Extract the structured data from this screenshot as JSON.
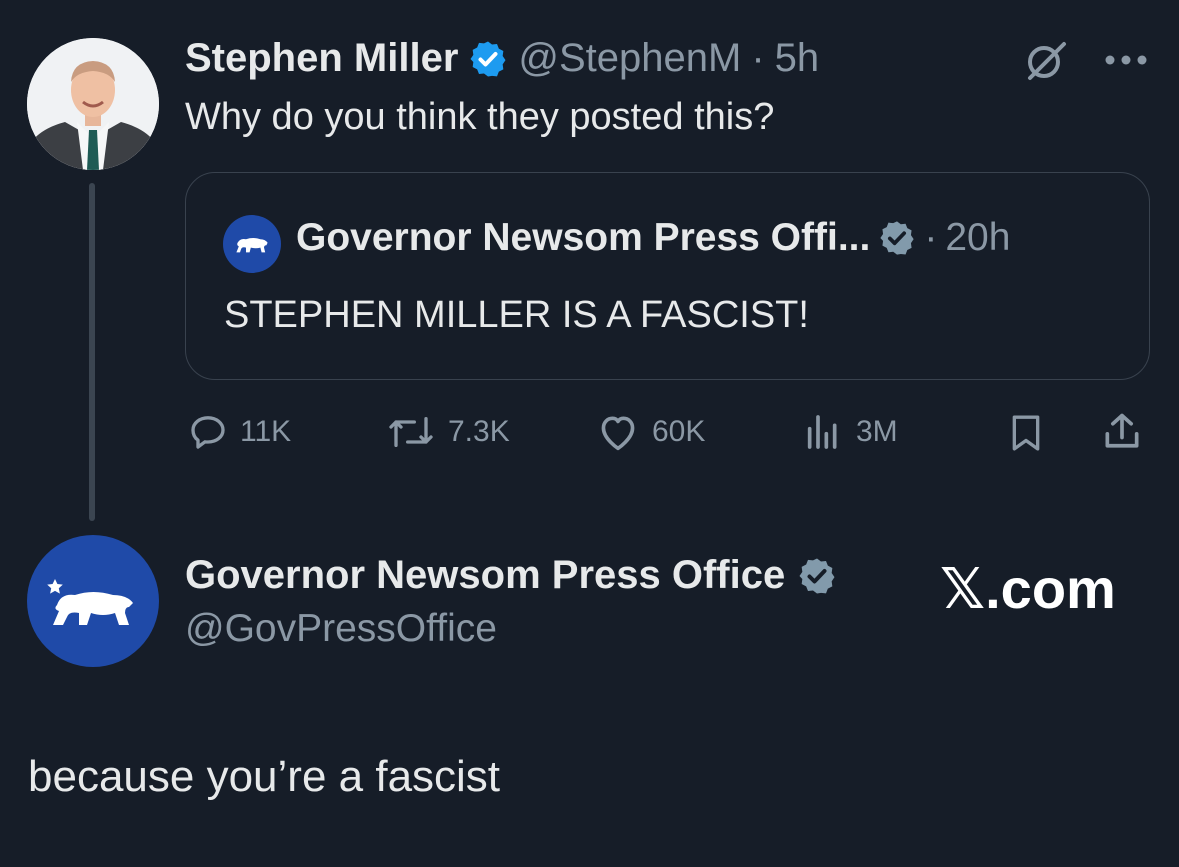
{
  "tweet": {
    "author_name": "Stephen Miller",
    "handle": "@StephenM",
    "separator": "·",
    "time": "5h",
    "text": "Why do you think they posted this?",
    "quote": {
      "author_name": "Governor Newsom Press Offi...",
      "separator": "·",
      "time": "20h",
      "text": "STEPHEN MILLER IS A FASCIST!"
    },
    "actions": {
      "replies": "11K",
      "reposts": "7.3K",
      "likes": "60K",
      "views": "3M"
    }
  },
  "reply": {
    "author_name": "Governor Newsom Press Office",
    "handle": "@GovPressOffice",
    "text": "because you’re a fascist"
  },
  "watermark": "𝕏.com",
  "colors": {
    "background": "#161d28",
    "verified_blue": "#1d9bf0",
    "verified_gray": "#829aab",
    "muted_text": "#8b98a5",
    "gov_blue": "#1f4aa8"
  },
  "icons": [
    "verified-badge-icon",
    "grok-icon",
    "more-icon",
    "reply-icon",
    "repost-icon",
    "like-icon",
    "views-icon",
    "bookmark-icon",
    "share-icon",
    "california-bear-icon"
  ]
}
